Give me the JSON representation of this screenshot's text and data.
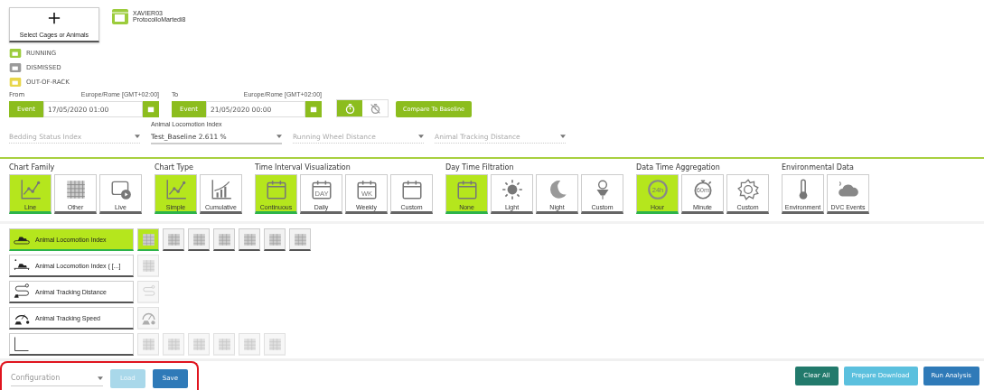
{
  "select_button": {
    "label": "Select Cages or Animals"
  },
  "cage": {
    "name": "XAVIER03",
    "protocol": "ProtocolloMartedi8"
  },
  "legend": [
    {
      "label": "RUNNING",
      "color": "#9ccc3c"
    },
    {
      "label": "DISMISSED",
      "color": "#9a9a9a"
    },
    {
      "label": "OUT-OF-RACK",
      "color": "#e8d64a"
    }
  ],
  "range": [
    {
      "label": "From",
      "timezone": "Europe/Rome [GMT+02:00]",
      "mode": "Event",
      "value": "17/05/2020 01:00"
    },
    {
      "label": "To",
      "timezone": "Europe/Rome [GMT+02:00]",
      "mode": "Event",
      "value": "21/05/2020 00:00"
    }
  ],
  "timer_toggle": [
    {
      "selected": true
    },
    {
      "selected": false
    }
  ],
  "compare_button": "Compare To Baseline",
  "dropdowns": [
    {
      "placeholder": "Bedding Status Index"
    },
    {
      "label": "Animal Locomotion Index",
      "value": "Test_Baseline 2.611 %"
    },
    {
      "placeholder": "Running Wheel Distance"
    },
    {
      "placeholder": "Animal Tracking Distance"
    }
  ],
  "option_groups": [
    {
      "title": "Chart Family",
      "items": [
        {
          "label": "Line",
          "selected": true
        },
        {
          "label": "Other",
          "selected": false
        },
        {
          "label": "Live",
          "selected": false
        }
      ]
    },
    {
      "title": "Chart Type",
      "items": [
        {
          "label": "Simple",
          "selected": true
        },
        {
          "label": "Cumulative",
          "selected": false
        }
      ]
    },
    {
      "title": "Time Interval Visualization",
      "items": [
        {
          "label": "Continuous",
          "selected": true
        },
        {
          "label": "Daily",
          "selected": false,
          "icon_text": "DAY"
        },
        {
          "label": "Weekly",
          "selected": false,
          "icon_text": "WK"
        },
        {
          "label": "Custom",
          "selected": false
        }
      ]
    },
    {
      "title": "Day Time Filtration",
      "items": [
        {
          "label": "None",
          "selected": true
        },
        {
          "label": "Light",
          "selected": false
        },
        {
          "label": "Night",
          "selected": false
        },
        {
          "label": "Custom",
          "selected": false
        }
      ]
    },
    {
      "title": "Data Time Aggregation",
      "items": [
        {
          "label": "Hour",
          "selected": true,
          "icon_text": "24h"
        },
        {
          "label": "Minute",
          "selected": false,
          "icon_text": "60m"
        },
        {
          "label": "Custom",
          "selected": false
        }
      ]
    },
    {
      "title": "Environmental Data",
      "items": [
        {
          "label": "Environment",
          "selected": false
        },
        {
          "label": "DVC Events",
          "selected": false
        }
      ]
    }
  ],
  "metrics": [
    {
      "label": "Animal Locomotion Index",
      "selected": true,
      "views": [
        {
          "kind": "grid",
          "selected": true,
          "disabled": false
        },
        {
          "kind": "grid",
          "selected": false,
          "disabled": false
        },
        {
          "kind": "grid",
          "selected": false,
          "disabled": false
        },
        {
          "kind": "grid",
          "selected": false,
          "disabled": false
        },
        {
          "kind": "grid",
          "selected": false,
          "disabled": false
        },
        {
          "kind": "grid",
          "selected": false,
          "disabled": false
        },
        {
          "kind": "grid",
          "selected": false,
          "disabled": false
        }
      ]
    },
    {
      "label": "Animal Locomotion Index ( [...]",
      "selected": false,
      "views": [
        {
          "kind": "grid",
          "selected": false,
          "disabled": true
        }
      ]
    },
    {
      "label": "Animal Tracking Distance",
      "selected": false,
      "views": [
        {
          "kind": "path",
          "selected": false,
          "disabled": true
        }
      ]
    },
    {
      "label": "Animal Tracking Speed",
      "selected": false,
      "views": [
        {
          "kind": "gauge",
          "selected": false,
          "disabled": true
        }
      ]
    },
    {
      "selected": false,
      "views": [
        {
          "kind": "grid",
          "selected": false,
          "disabled": true
        },
        {
          "kind": "grid",
          "selected": false,
          "disabled": true
        },
        {
          "kind": "grid",
          "selected": false,
          "disabled": true
        },
        {
          "kind": "grid",
          "selected": false,
          "disabled": true
        },
        {
          "kind": "grid",
          "selected": false,
          "disabled": true
        },
        {
          "kind": "grid",
          "selected": false,
          "disabled": true
        }
      ]
    }
  ],
  "footer": {
    "configuration": {
      "placeholder": "Configuration",
      "highlighted": true
    },
    "left_buttons": [
      {
        "label": "Load",
        "disabled": true,
        "color": "#a9d8ea"
      },
      {
        "label": "Save",
        "disabled": false,
        "color": "#2f7ab8"
      }
    ],
    "right_buttons": [
      {
        "label": "Clear All",
        "disabled": false,
        "color": "#227a6c"
      },
      {
        "label": "Prepare Download",
        "disabled": false,
        "color": "#5bc0de"
      },
      {
        "label": "Run Analysis",
        "disabled": false,
        "color": "#2f7ab8"
      }
    ]
  }
}
